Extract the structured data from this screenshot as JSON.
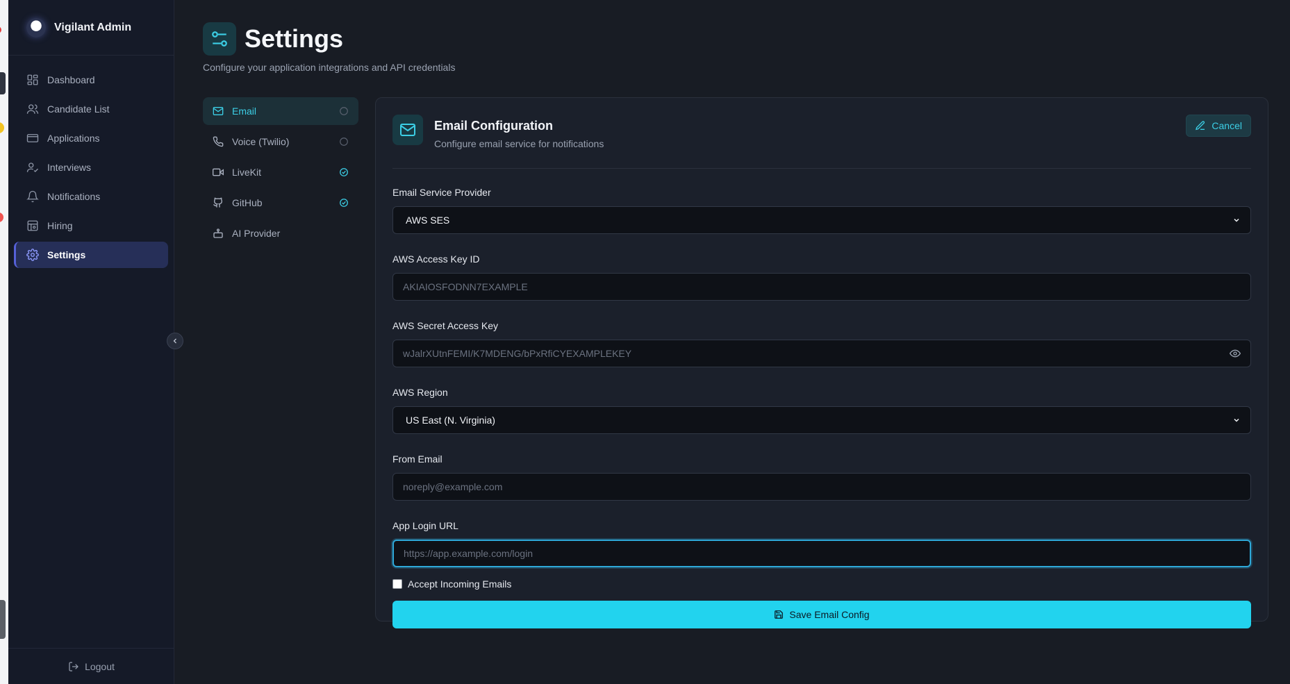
{
  "brand": {
    "name": "Vigilant Admin"
  },
  "sidebar": {
    "items": [
      {
        "label": "Dashboard",
        "icon": "dashboard-icon",
        "active": false
      },
      {
        "label": "Candidate List",
        "icon": "users-icon",
        "active": false
      },
      {
        "label": "Applications",
        "icon": "applications-icon",
        "active": false
      },
      {
        "label": "Interviews",
        "icon": "user-check-icon",
        "active": false
      },
      {
        "label": "Notifications",
        "icon": "bell-icon",
        "active": false
      },
      {
        "label": "Hiring",
        "icon": "hiring-icon",
        "active": false
      },
      {
        "label": "Settings",
        "icon": "gear-icon",
        "active": true
      }
    ],
    "logout_label": "Logout"
  },
  "page": {
    "title": "Settings",
    "subtitle": "Configure your application integrations and API credentials"
  },
  "tabs": [
    {
      "label": "Email",
      "icon": "mail-icon",
      "status": "unconfigured",
      "active": true
    },
    {
      "label": "Voice (Twilio)",
      "icon": "phone-icon",
      "status": "unconfigured",
      "active": false
    },
    {
      "label": "LiveKit",
      "icon": "video-icon",
      "status": "configured",
      "active": false
    },
    {
      "label": "GitHub",
      "icon": "github-icon",
      "status": "configured",
      "active": false
    },
    {
      "label": "AI Provider",
      "icon": "bot-icon",
      "status": "none",
      "active": false
    }
  ],
  "card": {
    "title": "Email Configuration",
    "description": "Configure email service for notifications",
    "cancel_label": "Cancel"
  },
  "form": {
    "provider": {
      "label": "Email Service Provider",
      "value": "AWS SES"
    },
    "access_key": {
      "label": "AWS Access Key ID",
      "placeholder": "AKIAIOSFODNN7EXAMPLE"
    },
    "secret_key": {
      "label": "AWS Secret Access Key",
      "placeholder": "wJalrXUtnFEMI/K7MDENG/bPxRfiCYEXAMPLEKEY"
    },
    "region": {
      "label": "AWS Region",
      "value": "US East (N. Virginia)"
    },
    "from_email": {
      "label": "From Email",
      "placeholder": "noreply@example.com"
    },
    "login_url": {
      "label": "App Login URL",
      "placeholder": "https://app.example.com/login"
    },
    "incoming": {
      "label": "Accept Incoming Emails",
      "checked": false
    },
    "save_label": "Save Email Config"
  },
  "colors": {
    "accent": "#22d3ee",
    "sidebar_active": "#262f58",
    "background": "#181c24"
  }
}
